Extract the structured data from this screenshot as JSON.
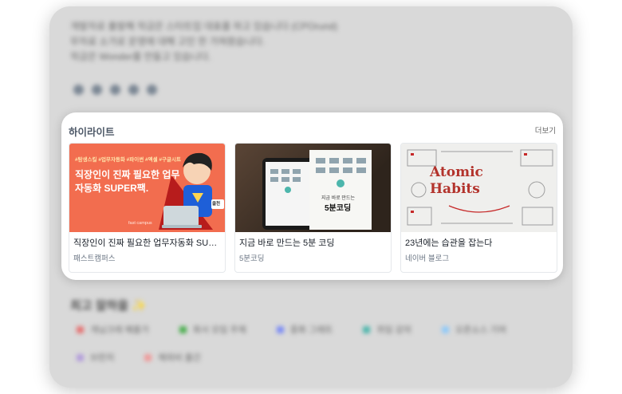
{
  "background": {
    "bio_lines": [
      "개발자로 출발해 작금은 스타트업 대표를 하고 있습니다 (CPOrund)",
      "무자료 소가로 운영에 대해 고민 한 가혀왔습니다.",
      "작금은 Wonder를 만들고 있습니다."
    ],
    "section_title": "최고 잘하을",
    "section_emoji": "✨",
    "chips": [
      {
        "label": "개님크레 예를가",
        "color": "#e57373"
      },
      {
        "label": "회사 모임 주제",
        "color": "#4caf50"
      },
      {
        "label": "중화 그래트",
        "color": "#7c8cf5"
      },
      {
        "label": "위임 강의",
        "color": "#4db6ac"
      },
      {
        "label": "오픈소스 기여",
        "color": "#90caf9"
      },
      {
        "label": "브런치",
        "color": "#b39ddb"
      },
      {
        "label": "해외비 출간",
        "color": "#ef9a9a"
      }
    ]
  },
  "highlight": {
    "title": "하이라이트",
    "more_label": "더보기",
    "cards": [
      {
        "title": "직장인이 진짜 필요한 업무자동화 SUPER팩",
        "source": "패스트캠퍼스",
        "thumb_tags": "#탐생스킬 #업무자동화 #파이썬 #엑셀 #구글시트",
        "thumb_headline": "직장인이 진짜 필요한 업무자동화 SUPER팩.",
        "thumb_brand": "fast campus",
        "thumb_badge": "클천"
      },
      {
        "title": "지금 바로 만드는 5분 코딩",
        "source": "5분코딩",
        "thumb_book_line1": "지금 바로 만드는",
        "thumb_book_line2": "5분코딩"
      },
      {
        "title": "23년에는 습관을 잡는다",
        "source": "네이버 블로그",
        "thumb_title_line1": "Atomic",
        "thumb_title_line2": "Habits"
      }
    ]
  }
}
